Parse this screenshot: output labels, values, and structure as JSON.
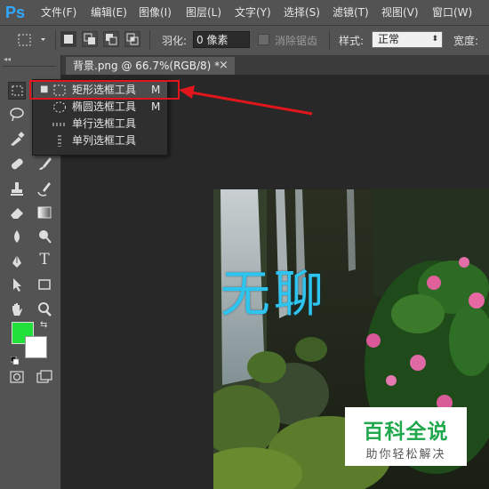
{
  "app": {
    "logo": "Ps"
  },
  "menu": {
    "items": [
      "文件(F)",
      "编辑(E)",
      "图像(I)",
      "图层(L)",
      "文字(Y)",
      "选择(S)",
      "滤镜(T)",
      "视图(V)",
      "窗口(W)"
    ]
  },
  "options": {
    "feather_label": "羽化:",
    "feather_value": "0 像素",
    "antialias_label": "消除锯齿",
    "style_label": "样式:",
    "style_value": "正常",
    "width_label": "宽度:"
  },
  "toolbox": {
    "collapse_glyph": "◂◂",
    "foreground_color": "#22e03a",
    "background_color": "#ffffff"
  },
  "document": {
    "tab_title": "背景.png @ 66.7%(RGB/8) *",
    "close_glyph": "×"
  },
  "flyout": {
    "items": [
      {
        "label": "矩形选框工具",
        "shortcut": "M",
        "icon": "rect-marquee-icon",
        "selected": true
      },
      {
        "label": "椭圆选框工具",
        "shortcut": "M",
        "icon": "ellipse-marquee-icon",
        "selected": false
      },
      {
        "label": "单行选框工具",
        "shortcut": "",
        "icon": "single-row-marquee-icon",
        "selected": false
      },
      {
        "label": "单列选框工具",
        "shortcut": "",
        "icon": "single-column-marquee-icon",
        "selected": false
      }
    ]
  },
  "canvas": {
    "art_text": "无聊",
    "watermark_title": "百科全说",
    "watermark_subtitle": "助你轻松解决"
  },
  "colors": {
    "annotation": "#e0161c",
    "ps_blue": "#31a8ff",
    "art_text": "#2ec4f0",
    "watermark_green": "#21a84d"
  }
}
